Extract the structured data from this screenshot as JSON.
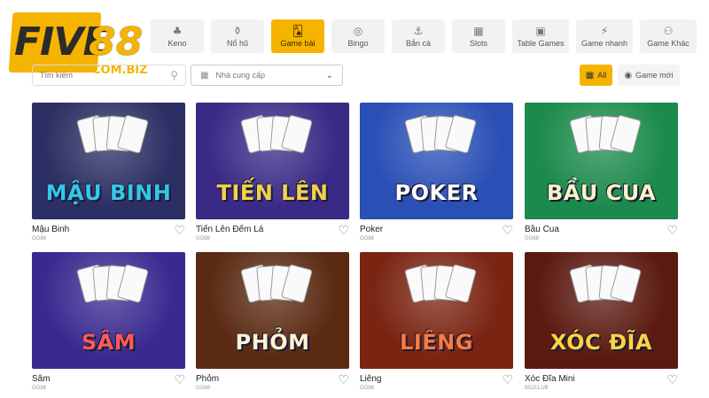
{
  "logo": {
    "five": "FIVE",
    "eightyeight": "88",
    "domain": "COM.BIZ"
  },
  "tabs": [
    {
      "label": "Keno",
      "icon": "keno-icon",
      "glyph": "♣",
      "active": false
    },
    {
      "label": "Nổ hũ",
      "icon": "slot-jar-icon",
      "glyph": "⚱",
      "active": false
    },
    {
      "label": "Game bài",
      "icon": "cards-icon",
      "glyph": "🂡",
      "active": true
    },
    {
      "label": "Bingo",
      "icon": "bingo-icon",
      "glyph": "◎",
      "active": false
    },
    {
      "label": "Bắn cá",
      "icon": "fish-shooting-icon",
      "glyph": "⚓",
      "active": false
    },
    {
      "label": "Slots",
      "icon": "slots-icon",
      "glyph": "▦",
      "active": false
    },
    {
      "label": "Table Games",
      "icon": "table-games-icon",
      "glyph": "▣",
      "active": false
    },
    {
      "label": "Game nhanh",
      "icon": "quick-game-icon",
      "glyph": "⚡",
      "active": false
    },
    {
      "label": "Game Khác",
      "icon": "other-games-icon",
      "glyph": "⚇",
      "active": false
    }
  ],
  "search": {
    "placeholder": "Tìm kiếm"
  },
  "provider": {
    "placeholder": "Nhà cung cấp"
  },
  "filters": {
    "all_label": "All",
    "new_label": "Game mới"
  },
  "games": [
    {
      "name": "Mậu Binh",
      "provider": "GO88",
      "art_title": "MẬU BINH",
      "bg": "#2b2f63",
      "title_color": "#35c7e8"
    },
    {
      "name": "Tiến Lên Đếm Lá",
      "provider": "GO88",
      "art_title": "TIẾN LÊN",
      "bg": "#3a2a86",
      "title_color": "#f3d24a"
    },
    {
      "name": "Poker",
      "provider": "GO88",
      "art_title": "POKER",
      "bg": "#2a4fb5",
      "title_color": "#ffffff"
    },
    {
      "name": "Bầu Cua",
      "provider": "GO88",
      "art_title": "BẦU CUA",
      "bg": "#1c8a4c",
      "title_color": "#f6f3c6"
    },
    {
      "name": "Sâm",
      "provider": "GO88",
      "art_title": "SÂM",
      "bg": "#3a2a90",
      "title_color": "#ff5a5a"
    },
    {
      "name": "Phỏm",
      "provider": "GO88",
      "art_title": "PHỎM",
      "bg": "#5a2a12",
      "title_color": "#fff3d0"
    },
    {
      "name": "Liêng",
      "provider": "GO88",
      "art_title": "LIÊNG",
      "bg": "#7a2412",
      "title_color": "#ff7a3a"
    },
    {
      "name": "Xóc Đĩa Mini",
      "provider": "B52CLUB",
      "art_title": "XÓC ĐĨA",
      "bg": "#5b1a10",
      "title_color": "#ffd340"
    }
  ]
}
